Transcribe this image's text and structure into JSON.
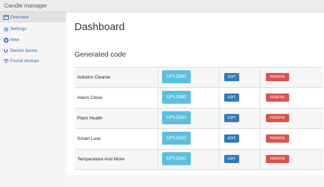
{
  "window": {
    "title": "Candle manager"
  },
  "sidebar": {
    "items": [
      {
        "label": "Overview",
        "icon": "dashboard-icon",
        "active": true
      },
      {
        "label": "Settings",
        "icon": "gear-icon",
        "active": false
      },
      {
        "label": "New",
        "icon": "plus-circle-icon",
        "active": false
      },
      {
        "label": "Device doctor",
        "icon": "stethoscope-icon",
        "active": false
      },
      {
        "label": "Found devices",
        "icon": "wifi-icon",
        "active": false
      }
    ]
  },
  "main": {
    "title": "Dashboard",
    "section_title": "Generated code",
    "rows": [
      {
        "name": "Arduino Cleaner",
        "upload": "UPLOAD",
        "edit": "EDIT",
        "remove": "REMOVE"
      },
      {
        "name": "Alarm Clock",
        "upload": "UPLOAD",
        "edit": "EDIT",
        "remove": "REMOVE"
      },
      {
        "name": "Plant Health",
        "upload": "UPLOAD",
        "edit": "EDIT",
        "remove": "REMOVE"
      },
      {
        "name": "Smart Lock",
        "upload": "UPLOAD",
        "edit": "EDIT",
        "remove": "REMOVE"
      },
      {
        "name": "Temperature And More",
        "upload": "UPLOAD",
        "edit": "EDIT",
        "remove": "REMOVE"
      }
    ]
  },
  "colors": {
    "upload": "#5bc0de",
    "edit": "#337ab7",
    "remove": "#d9534f",
    "link": "#2a6ab3"
  }
}
